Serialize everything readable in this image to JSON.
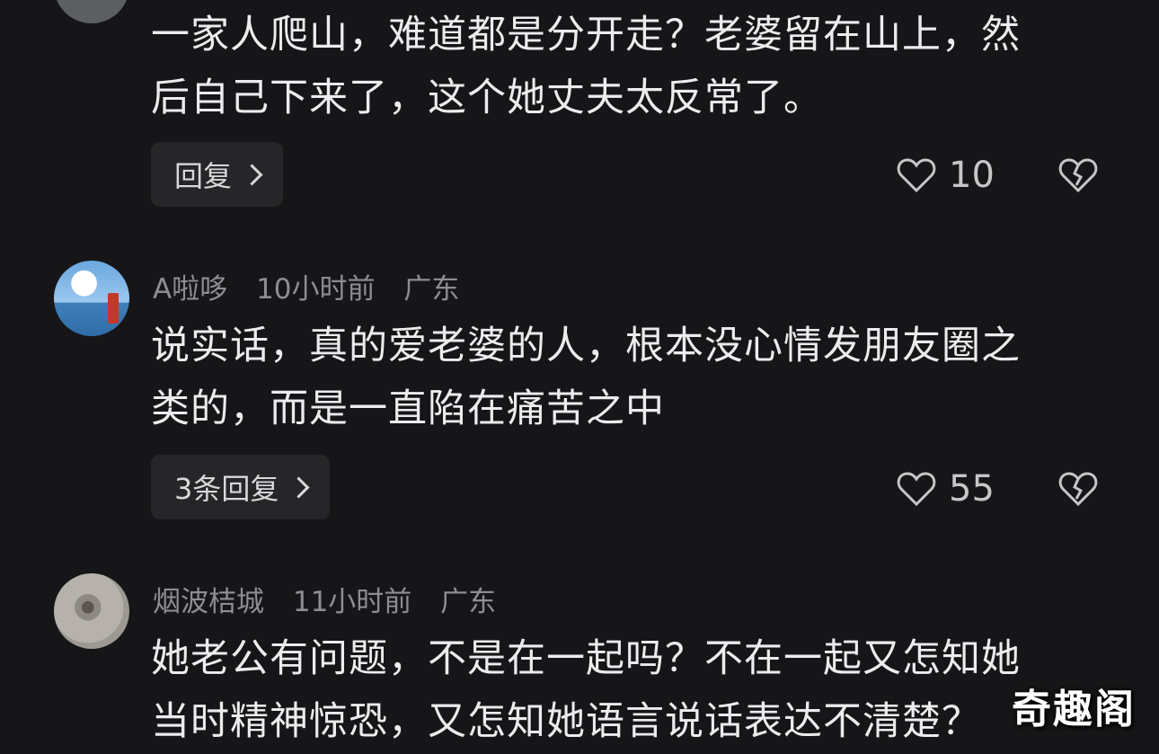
{
  "comments": [
    {
      "username": "",
      "time": "",
      "location": "",
      "text_lines": [
        "一家人爬山，难道都是分开走？老婆留在山上，然",
        "后自己下来了，这个她丈夫太反常了。"
      ],
      "reply_label": "回复",
      "likes": "10"
    },
    {
      "username": "A啦哆",
      "time": "10小时前",
      "location": "广东",
      "text_lines": [
        "说实话，真的爱老婆的人，根本没心情发朋友圈之",
        "类的，而是一直陷在痛苦之中"
      ],
      "reply_label": "3条回复",
      "likes": "55"
    },
    {
      "username": "烟波桔城",
      "time": "11小时前",
      "location": "广东",
      "text_lines": [
        "她老公有问题，不是在一起吗？不在一起又怎知她",
        "当时精神惊恐，又怎知她语言说话表达不清楚？"
      ]
    }
  ],
  "watermark": "奇趣阁",
  "icons": {
    "like": "heart-outline-icon",
    "dislike": "broken-heart-icon",
    "reply_chevron": "chevron-right-icon"
  },
  "colors": {
    "background": "#161618",
    "text": "#ececee",
    "meta": "#8d8d92",
    "button_bg": "#262628"
  }
}
